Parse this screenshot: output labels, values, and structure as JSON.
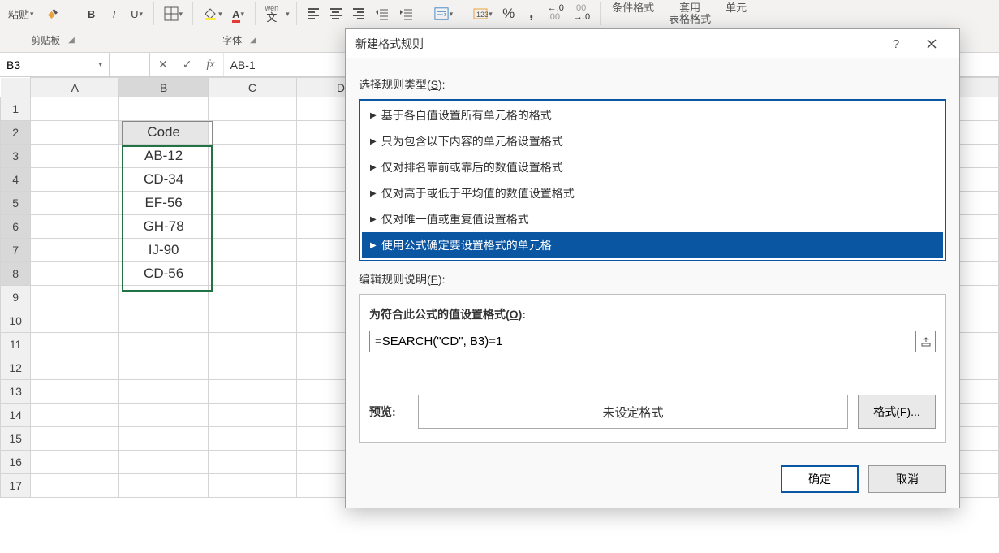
{
  "ribbon": {
    "paste_label": "粘贴",
    "wen_label": "wén",
    "wen_char": "文",
    "cond_fmt": "条件格式",
    "table_fmt": "套用\n表格格式",
    "cell_style": "单元",
    "group_clipboard": "剪贴板",
    "group_font": "字体",
    "pct": "%",
    "comma": ","
  },
  "formula_bar": {
    "namebox": "B3",
    "fx": "fx",
    "value": "AB-1"
  },
  "columns": [
    "A",
    "B",
    "C",
    "D"
  ],
  "rows": [
    "1",
    "2",
    "3",
    "4",
    "5",
    "6",
    "7",
    "8",
    "9",
    "10",
    "11",
    "12",
    "13",
    "14",
    "15",
    "16",
    "17"
  ],
  "cells": {
    "B2": "Code",
    "B3": "AB-12",
    "B4": "CD-34",
    "B5": "EF-56",
    "B6": "GH-78",
    "B7": "IJ-90",
    "B8": "CD-56"
  },
  "dialog": {
    "title": "新建格式规则",
    "help": "?",
    "section_rule_type": "选择规则类型(",
    "section_rule_type_key": "S",
    "section_rule_type_end": "):",
    "rules": [
      "基于各自值设置所有单元格的格式",
      "只为包含以下内容的单元格设置格式",
      "仅对排名靠前或靠后的数值设置格式",
      "仅对高于或低于平均值的数值设置格式",
      "仅对唯一值或重复值设置格式",
      "使用公式确定要设置格式的单元格"
    ],
    "section_edit": "编辑规则说明(",
    "section_edit_key": "E",
    "section_edit_end": "):",
    "formula_label": "为符合此公式的值设置格式(",
    "formula_label_key": "O",
    "formula_label_end": "):",
    "formula_value": "=SEARCH(\"CD\", B3)=1",
    "preview_label": "预览:",
    "preview_value": "未设定格式",
    "format_btn": "格式(F)...",
    "ok": "确定",
    "cancel": "取消"
  }
}
